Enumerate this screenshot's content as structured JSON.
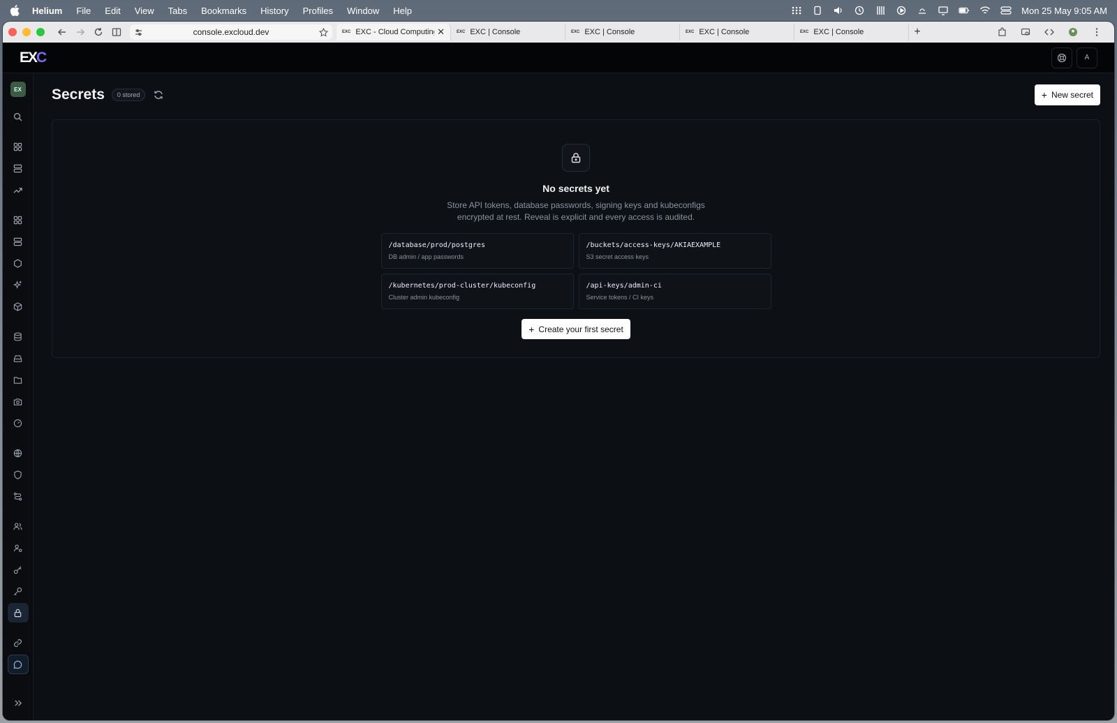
{
  "menubar": {
    "app_name": "Helium",
    "items": [
      "File",
      "Edit",
      "View",
      "Tabs",
      "Bookmarks",
      "History",
      "Profiles",
      "Window",
      "Help"
    ],
    "clock": "Mon 25 May  9:05 AM"
  },
  "browser": {
    "url": "console.excloud.dev",
    "tabs": [
      {
        "favicon": "EXC",
        "label": "EXC - Cloud Computing",
        "active": true
      },
      {
        "favicon": "EXC",
        "label": "EXC | Console"
      },
      {
        "favicon": "EXC",
        "label": "EXC | Console"
      },
      {
        "favicon": "EXC",
        "label": "EXC | Console"
      },
      {
        "favicon": "EXC",
        "label": "EXC | Console"
      }
    ],
    "new_tab": "+"
  },
  "app": {
    "logo_main": "EX",
    "logo_accent": "C",
    "avatar_letter": "A",
    "org_badge": "EX"
  },
  "page": {
    "title": "Secrets",
    "stored_badge": "0 stored",
    "new_secret_label": "New secret",
    "empty_title": "No secrets yet",
    "empty_desc_line1": "Store API tokens, database passwords, signing keys and kubeconfigs",
    "empty_desc_line2": "encrypted at rest. Reveal is explicit and every access is audited.",
    "examples": [
      {
        "path": "/database/prod/postgres",
        "desc": "DB admin / app passwords"
      },
      {
        "path": "/buckets/access-keys/AKIAEXAMPLE",
        "desc": "S3 secret access keys"
      },
      {
        "path": "/kubernetes/prod-cluster/kubeconfig",
        "desc": "Cluster admin kubeconfig"
      },
      {
        "path": "/api-keys/admin-ci",
        "desc": "Service tokens / CI keys"
      }
    ],
    "create_first_label": "Create your first secret"
  },
  "colors": {
    "accent": "#7c6cf0",
    "background": "#0c0f14",
    "button_bg": "#ffffff"
  }
}
